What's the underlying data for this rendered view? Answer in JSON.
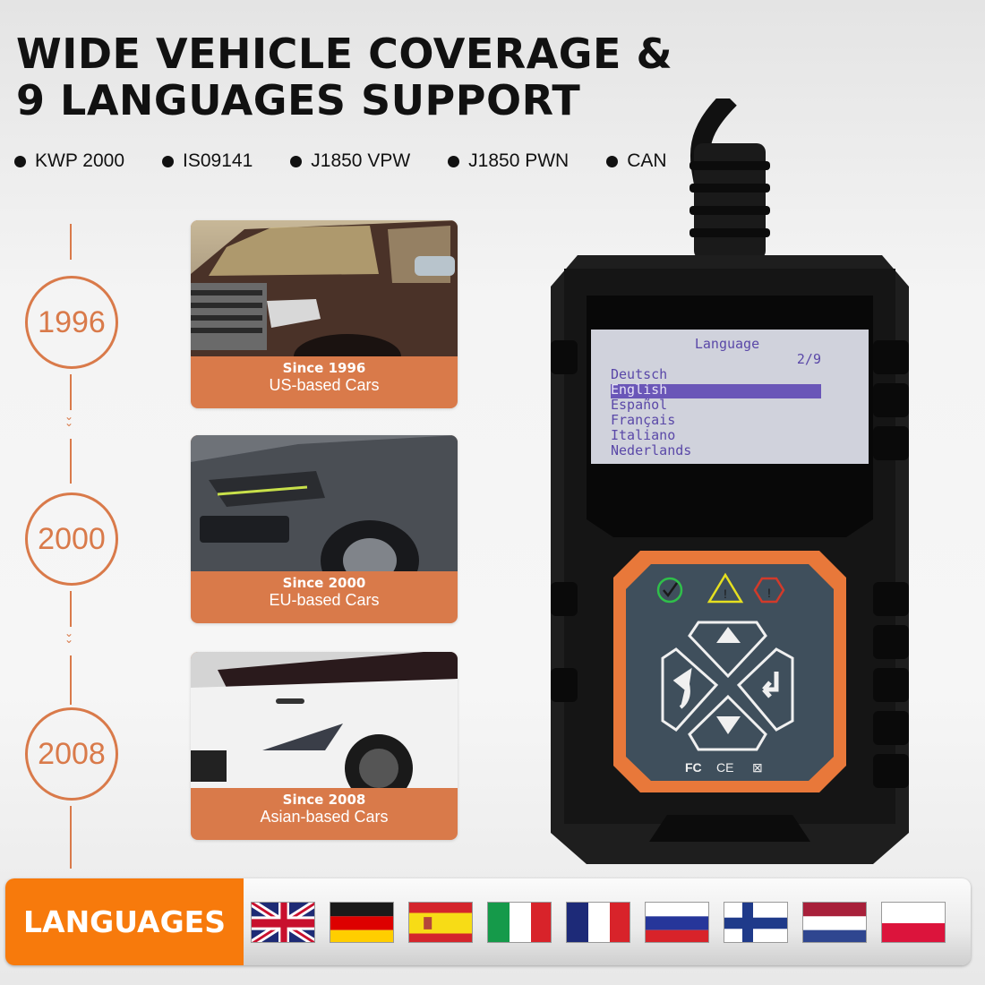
{
  "header": {
    "title_line1": "WIDE VEHICLE COVERAGE &",
    "title_line2": "9 LANGUAGES SUPPORT"
  },
  "protocols": [
    "KWP 2000",
    "IS09141",
    "J1850 VPW",
    "J1850 PWN",
    "CAN"
  ],
  "timeline": [
    {
      "year": "1996",
      "since": "Since 1996",
      "region": "US-based Cars"
    },
    {
      "year": "2000",
      "since": "Since 2000",
      "region": "EU-based Cars"
    },
    {
      "year": "2008",
      "since": "Since 2008",
      "region": "Asian-based Cars"
    }
  ],
  "screen": {
    "title": "Language",
    "page": "2/9",
    "items": [
      "Deutsch",
      "English",
      "Español",
      "Français",
      "Italiano",
      "Nederlands"
    ],
    "selected_index": 1
  },
  "keypad": {
    "status_icons": [
      "ok-check-icon",
      "warning-triangle-icon",
      "error-hexagon-icon"
    ],
    "buttons": [
      "up-button",
      "back-button",
      "enter-button",
      "down-button"
    ],
    "certifications": [
      "FC",
      "CE",
      "WEEE"
    ]
  },
  "languages_banner": {
    "label": "LANGUAGES",
    "flags": [
      "uk",
      "germany",
      "spain",
      "italy",
      "france",
      "russia",
      "finland",
      "netherlands",
      "poland"
    ]
  },
  "colors": {
    "accent_orange": "#d97a4a",
    "banner_orange": "#f77a0c",
    "screen_text": "#5a48a8"
  }
}
